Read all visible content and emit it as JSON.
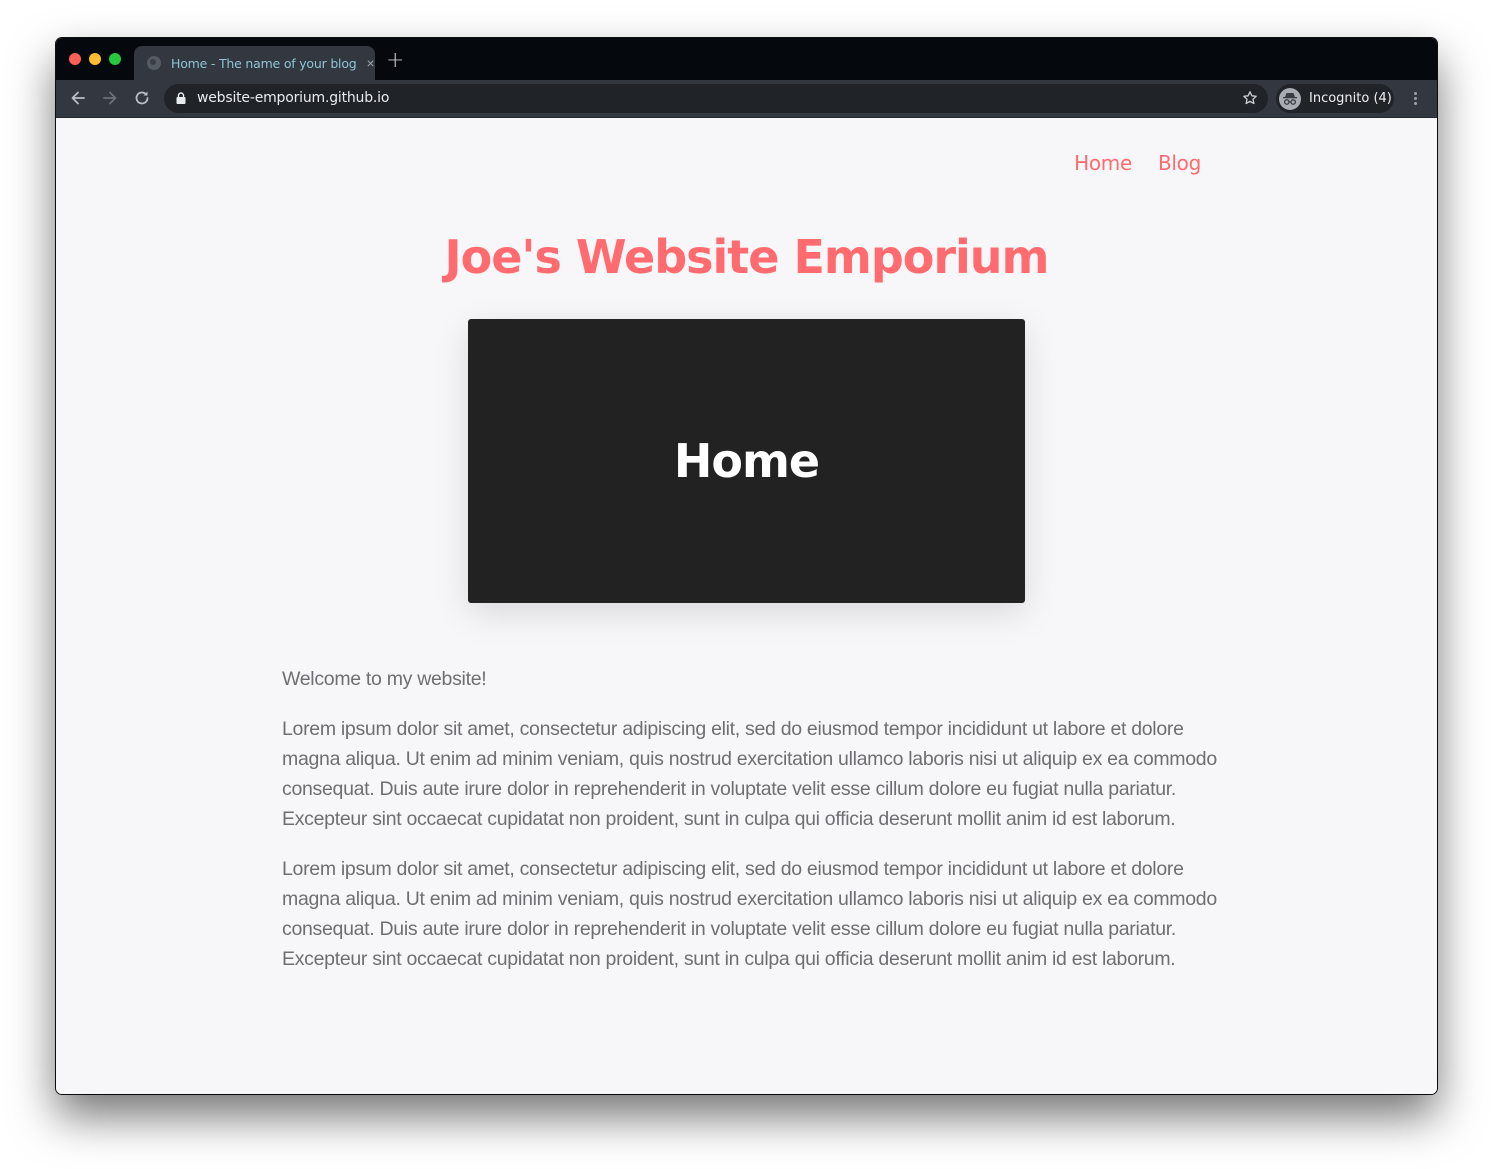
{
  "browser": {
    "tab": {
      "title": "Home - The name of your blog",
      "favicon": "globe-icon",
      "close_icon": "×"
    },
    "new_tab_icon": "+",
    "toolbar": {
      "back_icon": "arrow-left",
      "forward_icon": "arrow-right",
      "reload_icon": "reload",
      "url": "website-emporium.github.io",
      "bookmark_icon": "star",
      "profile_label": "Incognito (4)",
      "menu_icon": "vertical-dots"
    },
    "colors": {
      "tab_title": "#8fc5d3",
      "chrome_dark": "#05080d",
      "chrome_toolbar": "#323740",
      "omnibox": "#202328"
    }
  },
  "site": {
    "nav": [
      {
        "label": "Home"
      },
      {
        "label": "Blog"
      }
    ],
    "title": "Joe's Website Emporium",
    "hero_title": "Home",
    "paragraphs": [
      "Welcome to my website!",
      "Lorem ipsum dolor sit amet, consectetur adipiscing elit, sed do eiusmod tempor incididunt ut labore et dolore magna aliqua. Ut enim ad minim veniam, quis nostrud exercitation ullamco laboris nisi ut aliquip ex ea commodo consequat. Duis aute irure dolor in reprehenderit in voluptate velit esse cillum dolore eu fugiat nulla pariatur. Excepteur sint occaecat cupidatat non proident, sunt in culpa qui officia deserunt mollit anim id est laborum.",
      "Lorem ipsum dolor sit amet, consectetur adipiscing elit, sed do eiusmod tempor incididunt ut labore et dolore magna aliqua. Ut enim ad minim veniam, quis nostrud exercitation ullamco laboris nisi ut aliquip ex ea commodo consequat. Duis aute irure dolor in reprehenderit in voluptate velit esse cillum dolore eu fugiat nulla pariatur. Excepteur sint occaecat cupidatat non proident, sunt in culpa qui officia deserunt mollit anim id est laborum."
    ],
    "colors": {
      "accent": "#ff6b6f",
      "hero_bg": "#222222",
      "page_bg": "#f7f7f9",
      "body_text": "#6f6f72"
    }
  }
}
